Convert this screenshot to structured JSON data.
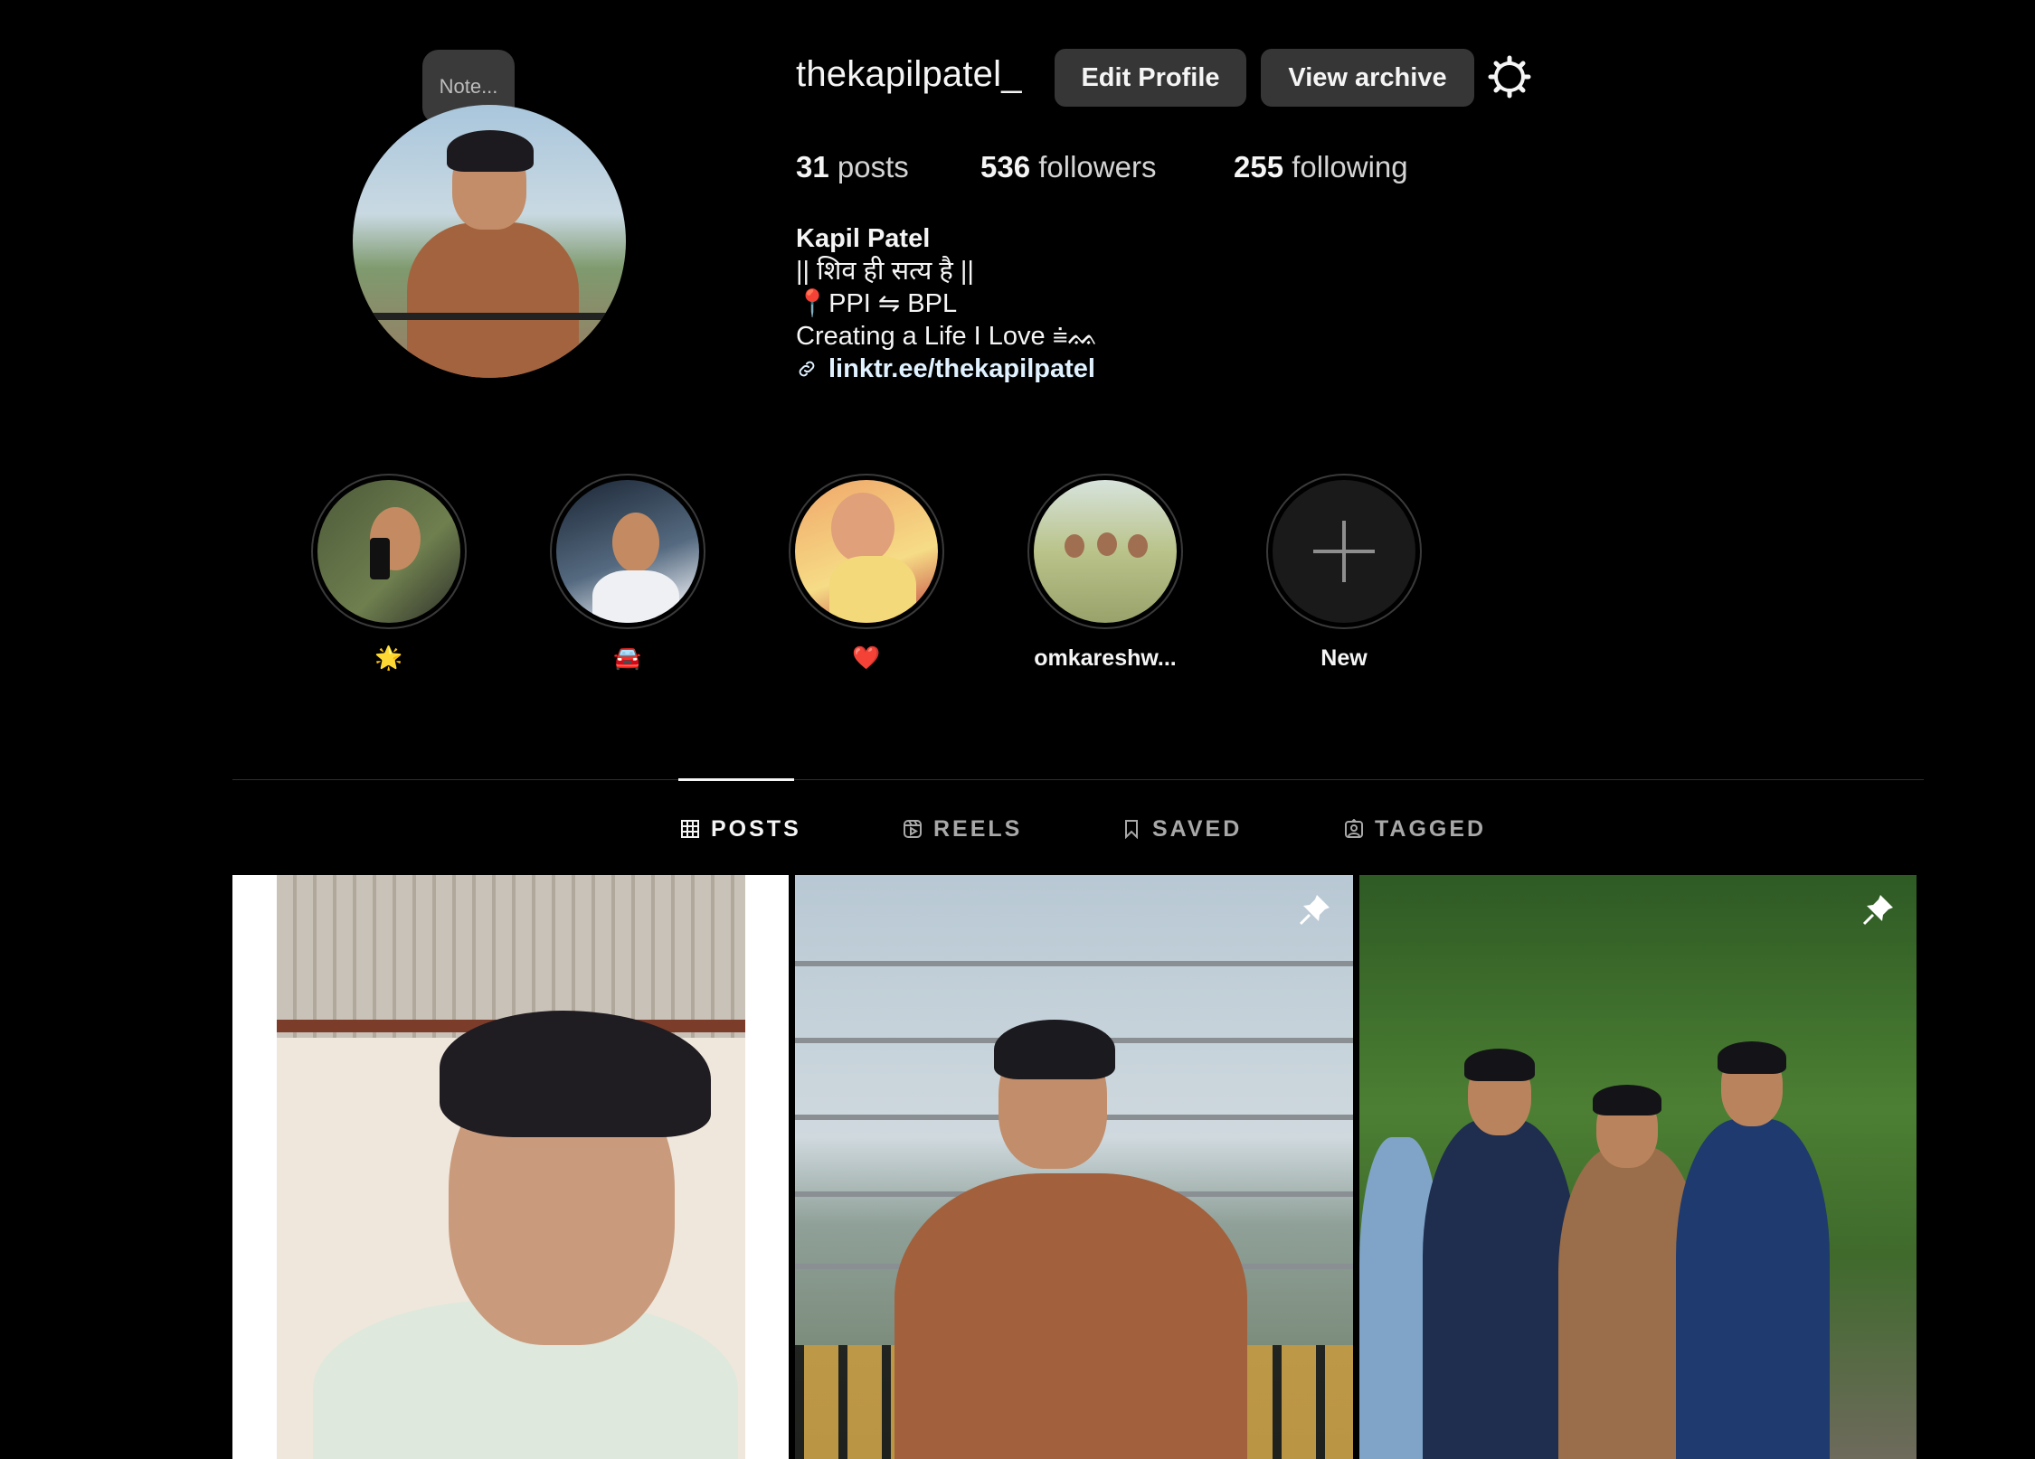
{
  "profile": {
    "username": "thekapilpatel_",
    "note_placeholder": "Note...",
    "edit_profile_label": "Edit Profile",
    "view_archive_label": "View archive",
    "settings_icon": "gear-icon"
  },
  "stats": {
    "posts_count": "31",
    "posts_label": "posts",
    "followers_count": "536",
    "followers_label": "followers",
    "following_count": "255",
    "following_label": "following"
  },
  "bio": {
    "name": "Kapil Patel",
    "line1": "|| शिव ही सत्य है ||",
    "line2": "📍PPI ⇋ BPL",
    "line3": "Creating a Life I Love ⩧ᨐ",
    "link": "linktr.ee/thekapilpatel"
  },
  "highlights": [
    {
      "label": "🌟"
    },
    {
      "label": "🚘"
    },
    {
      "label": "❤️"
    },
    {
      "label": "omkareshw..."
    },
    {
      "label": "New"
    }
  ],
  "tabs": [
    {
      "label": "POSTS",
      "active": true
    },
    {
      "label": "REELS",
      "active": false
    },
    {
      "label": "SAVED",
      "active": false
    },
    {
      "label": "TAGGED",
      "active": false
    }
  ],
  "colors": {
    "background": "#000000",
    "button_bg": "#363636",
    "text_primary": "#f5f5f5",
    "text_secondary": "#a8a8a8",
    "link": "#e0f1ff"
  }
}
